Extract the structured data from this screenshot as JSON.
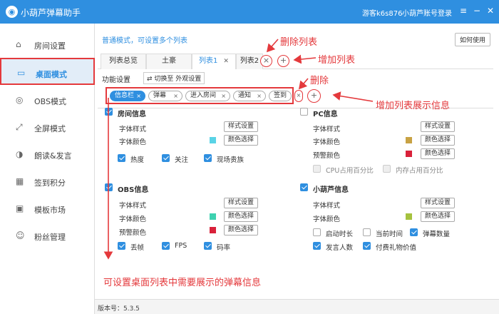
{
  "titlebar": {
    "app_title": "小葫芦弹幕助手",
    "guest": "游客k6s876",
    "login": "小葫芦账号登录"
  },
  "sidebar": {
    "items": [
      {
        "label": "房间设置",
        "icon": "home-icon"
      },
      {
        "label": "桌面模式",
        "icon": "desktop-icon"
      },
      {
        "label": "OBS模式",
        "icon": "obs-icon"
      },
      {
        "label": "全屏模式",
        "icon": "fullscreen-icon"
      },
      {
        "label": "朗读&发言",
        "icon": "speaker-icon"
      },
      {
        "label": "签到积分",
        "icon": "calendar-icon"
      },
      {
        "label": "模板市场",
        "icon": "market-icon"
      },
      {
        "label": "粉丝管理",
        "icon": "fans-icon"
      }
    ]
  },
  "main": {
    "mode_text": "普通模式，可设置多个列表",
    "help_label": "如何使用",
    "tabs": [
      "列表总览",
      "土豪",
      "列表1",
      "列表2"
    ],
    "section_title": "功能设置",
    "switch_label": "切换至 外观设置",
    "tags": [
      "信息栏",
      "弹幕",
      "进入房间",
      "通知",
      "签到"
    ]
  },
  "annotations": {
    "delete_list": "删除列表",
    "add_list": "增加列表",
    "delete": "删除",
    "add_info": "增加列表展示信息",
    "bottom": "可设置桌面列表中需要展示的弹幕信息"
  },
  "panels": {
    "room": {
      "title": "房间信息",
      "font_style": "字体样式",
      "font_color": "字体颜色",
      "style_btn": "样式设置",
      "color_btn": "颜色选择",
      "swatch": "#5ad3e6",
      "checks": [
        "热度",
        "关注",
        "现场贵族"
      ]
    },
    "pc": {
      "title": "PC信息",
      "font_style": "字体样式",
      "font_color": "字体颜色",
      "warn_color": "预警颜色",
      "style_btn": "样式设置",
      "color_btn": "颜色选择",
      "color_btn2": "颜色选择",
      "swatch1": "#c8a244",
      "swatch2": "#d9213a",
      "checks": [
        "CPU占用百分比",
        "内存占用百分比"
      ]
    },
    "obs": {
      "title": "OBS信息",
      "font_style": "字体样式",
      "font_color": "字体颜色",
      "warn_color": "预警颜色",
      "style_btn": "样式设置",
      "color_btn": "颜色选择",
      "color_btn2": "颜色选择",
      "swatch1": "#3ed1b0",
      "swatch2": "#d9213a",
      "checks": [
        "丢帧",
        "FPS",
        "码率"
      ]
    },
    "hulu": {
      "title": "小葫芦信息",
      "font_style": "字体样式",
      "font_color": "字体颜色",
      "style_btn": "样式设置",
      "color_btn": "颜色选择",
      "swatch": "#a5c23f",
      "checks": [
        "启动时长",
        "当前时间",
        "弹幕数量",
        "发言人数",
        "付费礼物价值"
      ]
    }
  },
  "footer": {
    "version": "版本号：5.3.5"
  }
}
